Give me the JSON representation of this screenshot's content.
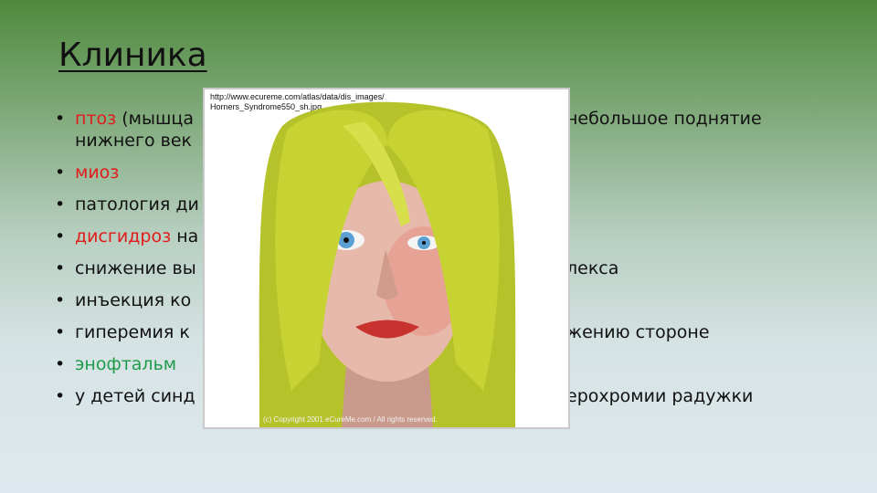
{
  "slide": {
    "title": "Клиника",
    "bullets": [
      {
        "parts": [
          {
            "text": "птоз",
            "color": "red"
          },
          {
            "text": " (мышца",
            "color": "dark"
          },
          {
            "text": "небольшое поднятие",
            "color": "dark",
            "gap": true
          }
        ],
        "line2": "нижнего век"
      },
      {
        "parts": [
          {
            "text": "миоз",
            "color": "red"
          }
        ]
      },
      {
        "parts": [
          {
            "text": "патология ди",
            "color": "dark"
          }
        ]
      },
      {
        "parts": [
          {
            "text": "дисгидроз",
            "color": "red"
          },
          {
            "text": " на",
            "color": "dark"
          }
        ]
      },
      {
        "parts": [
          {
            "text": "снижение вы",
            "color": "dark"
          },
          {
            "text": "лекса",
            "color": "dark",
            "gap": true
          }
        ]
      },
      {
        "parts": [
          {
            "text": "инъекция  ко",
            "color": "dark"
          }
        ]
      },
      {
        "parts": [
          {
            "text": "гиперемия к",
            "color": "dark"
          },
          {
            "text": "жению стороне",
            "color": "dark",
            "gap": true
          }
        ]
      },
      {
        "parts": [
          {
            "text": " энофтальм",
            "color": "green"
          }
        ]
      },
      {
        "parts": [
          {
            "text": "у детей синд",
            "color": "dark"
          },
          {
            "text": "ерохромии радужки",
            "color": "dark",
            "gap": true
          }
        ]
      }
    ]
  },
  "photo": {
    "caption": "http://www.ecureme.com/atlas/data/dis_images/\nHorners_Syndrome550_sh.jpg",
    "copyright": "(c) Copyright 2001 eCureMe.com / All rights reserved."
  },
  "colors": {
    "red": "#e21b1b",
    "green": "#1f9a4a",
    "dark": "#111111"
  }
}
